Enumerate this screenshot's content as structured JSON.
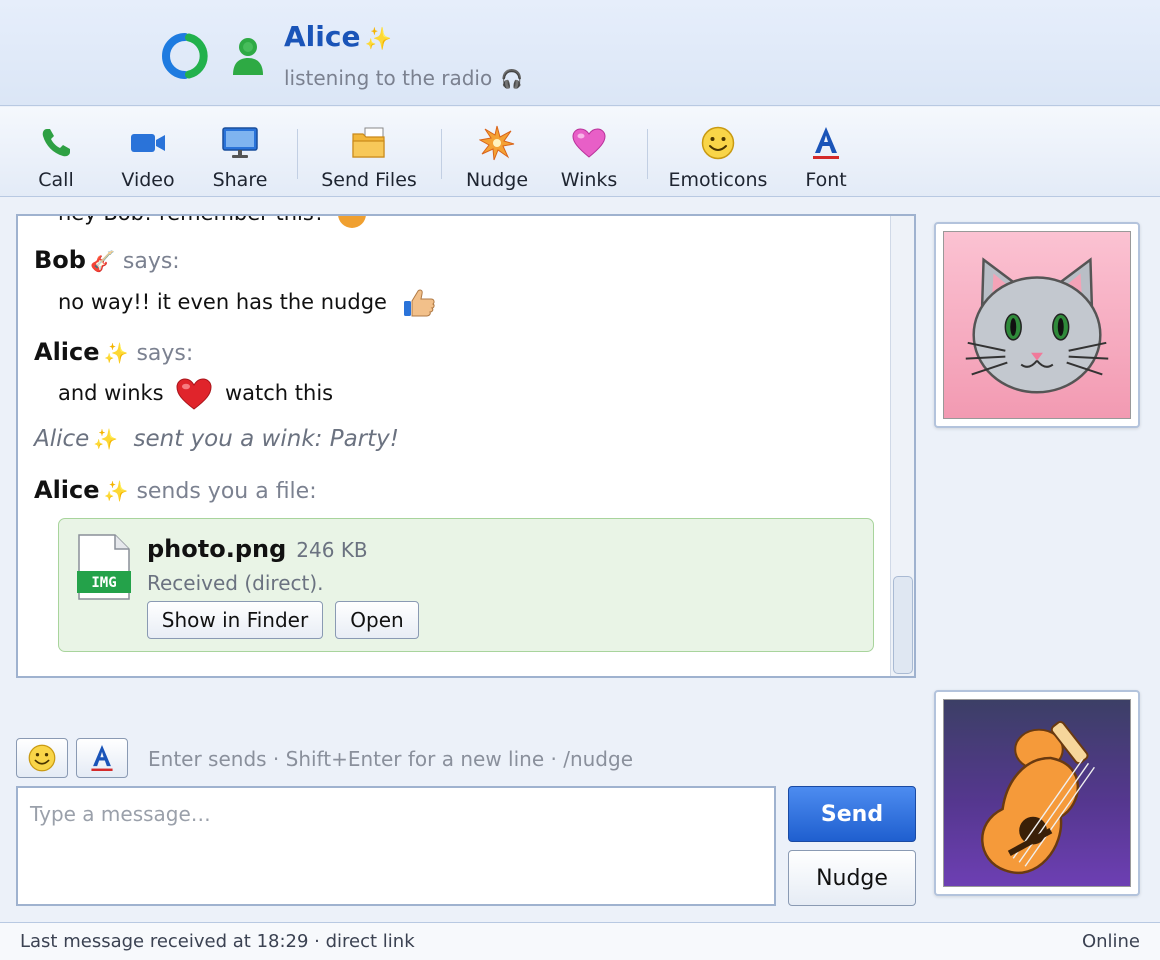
{
  "header": {
    "contact_name": "Alice",
    "name_emoji": "✨",
    "status_message": "listening to the radio",
    "status_emoji": "🎧"
  },
  "toolbar": {
    "items": [
      {
        "label": "Call",
        "icon": "phone-icon"
      },
      {
        "label": "Video",
        "icon": "video-camera-icon"
      },
      {
        "label": "Share",
        "icon": "screen-share-icon"
      },
      {
        "label": "Send Files",
        "icon": "folder-icon"
      },
      {
        "label": "Nudge",
        "icon": "nudge-burst-icon"
      },
      {
        "label": "Winks",
        "icon": "heart-icon"
      },
      {
        "label": "Emoticons",
        "icon": "smiley-icon"
      },
      {
        "label": "Font",
        "icon": "font-icon"
      }
    ]
  },
  "conversation": {
    "cut_off_line": "hey Bob! remember this?",
    "messages": [
      {
        "sender": "Bob",
        "sender_emoji": "🎸",
        "verb": "says:",
        "text": "no way!! it even has the nudge"
      },
      {
        "sender": "Alice",
        "sender_emoji": "✨",
        "verb": "says:",
        "text_before": "and winks",
        "text_after": "watch this"
      }
    ],
    "wink_notice": {
      "sender": "Alice",
      "sender_emoji": "✨",
      "text": "sent you a wink: Party!"
    },
    "file_transfer": {
      "sender": "Alice",
      "sender_emoji": "✨",
      "verb": "sends you a file:",
      "file_name": "photo.png",
      "file_size": "246 KB",
      "file_type_badge": "IMG",
      "status": "Received (direct).",
      "show_in_finder_label": "Show in Finder",
      "open_label": "Open"
    }
  },
  "compose": {
    "hint": "Enter sends · Shift+Enter for a new line · /nudge",
    "placeholder": "Type a message…",
    "send_label": "Send",
    "nudge_label": "Nudge"
  },
  "statusbar": {
    "left": "Last message received at 18:29 · direct link",
    "right": "Online"
  },
  "colors": {
    "accent_blue": "#1a54b8",
    "file_card_bg": "#e9f4e6",
    "send_button": "#2f6fe0"
  }
}
